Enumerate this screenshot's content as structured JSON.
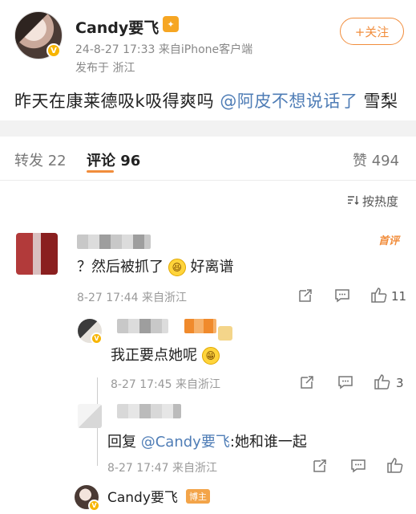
{
  "post": {
    "author": "Candy要飞",
    "meta": "24-8-27 17:33  来自iPhone客户端",
    "location": "发布于 浙江",
    "follow_label": "+关注",
    "text_before": "昨天在康莱德吸k吸得爽吗 ",
    "mention": "@阿皮不想说话了",
    "text_after": " 雪梨"
  },
  "tabs": {
    "repost_label": "转发",
    "repost_count": "22",
    "comment_label": "评论",
    "comment_count": "96",
    "like_label": "赞",
    "like_count": "494"
  },
  "sort_label": "按热度",
  "comments": {
    "c1": {
      "badge": "首评",
      "text_before": "？然后被抓了",
      "text_after": "好离谱",
      "meta": "8-27 17:44  来自浙江",
      "likes": "11"
    },
    "r1": {
      "text": "我正要点她呢",
      "meta": "8-27 17:45  来自浙江",
      "likes": "3"
    },
    "r2": {
      "reply_prefix": "回复",
      "mention": "@Candy要飞",
      "text": ":她和谁一起",
      "meta": "8-27 17:47  来自浙江"
    },
    "r3": {
      "author": "Candy要飞",
      "badge": "博主"
    }
  },
  "colors": {
    "accent": "#f18d3c",
    "link": "#4f7db6"
  }
}
